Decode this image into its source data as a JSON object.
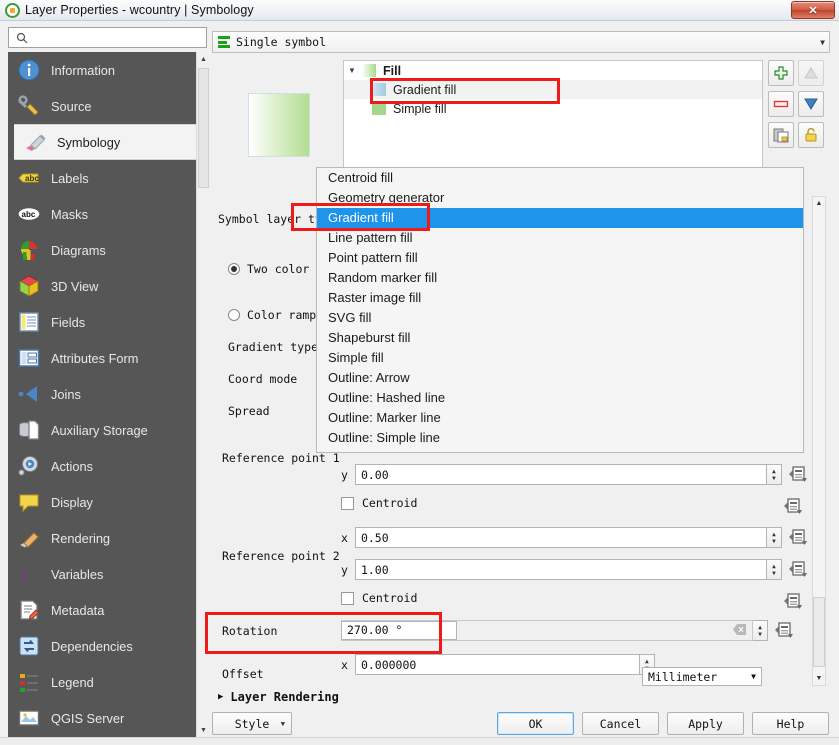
{
  "window": {
    "title": "Layer Properties - wcountry | Symbology",
    "app_icon": "qgis-icon",
    "close_label": "✕"
  },
  "search": {
    "value": "",
    "placeholder": "",
    "icon": "search-icon"
  },
  "sidebar": {
    "items": [
      {
        "label": "Information",
        "icon": "information-icon",
        "selected": false
      },
      {
        "label": "Source",
        "icon": "source-icon",
        "selected": false
      },
      {
        "label": "Symbology",
        "icon": "symbology-brush-icon",
        "selected": true
      },
      {
        "label": "Labels",
        "icon": "labels-abc-icon",
        "selected": false
      },
      {
        "label": "Masks",
        "icon": "masks-abc-icon",
        "selected": false
      },
      {
        "label": "Diagrams",
        "icon": "diagrams-chart-icon",
        "selected": false
      },
      {
        "label": "3D View",
        "icon": "cube-3d-icon",
        "selected": false
      },
      {
        "label": "Fields",
        "icon": "fields-table-icon",
        "selected": false
      },
      {
        "label": "Attributes Form",
        "icon": "attributes-form-icon",
        "selected": false
      },
      {
        "label": "Joins",
        "icon": "joins-icon",
        "selected": false
      },
      {
        "label": "Auxiliary Storage",
        "icon": "auxiliary-storage-icon",
        "selected": false
      },
      {
        "label": "Actions",
        "icon": "actions-gear-icon",
        "selected": false
      },
      {
        "label": "Display",
        "icon": "display-balloon-icon",
        "selected": false
      },
      {
        "label": "Rendering",
        "icon": "rendering-brush-icon",
        "selected": false
      },
      {
        "label": "Variables",
        "icon": "variables-epsilon-icon",
        "selected": false
      },
      {
        "label": "Metadata",
        "icon": "metadata-pencil-icon",
        "selected": false
      },
      {
        "label": "Dependencies",
        "icon": "dependencies-arrows-icon",
        "selected": false
      },
      {
        "label": "Legend",
        "icon": "legend-icon",
        "selected": false
      },
      {
        "label": "QGIS Server",
        "icon": "qgis-server-icon",
        "selected": false
      }
    ]
  },
  "renderer": {
    "label": "Single symbol",
    "icon": "single-symbol-icon"
  },
  "symbol_tree": {
    "rows": [
      {
        "label": "Fill",
        "swatch": "fill-gradient-swatch",
        "level": 0,
        "selected": false,
        "bold": true
      },
      {
        "label": "Gradient fill",
        "swatch": "gradient-fill-swatch",
        "level": 1,
        "selected": true,
        "bold": false
      },
      {
        "label": "Simple fill",
        "swatch": "simple-fill-swatch",
        "level": 1,
        "selected": false,
        "bold": false
      }
    ]
  },
  "layer_buttons": [
    {
      "name": "add-symbol-layer-button",
      "icon": "plus-icon",
      "disabled": false
    },
    {
      "name": "move-up-button",
      "icon": "triangle-up-icon",
      "disabled": true
    },
    {
      "name": "remove-symbol-layer-button",
      "icon": "minus-icon",
      "disabled": false
    },
    {
      "name": "move-down-button",
      "icon": "triangle-down-icon",
      "disabled": false
    },
    {
      "name": "duplicate-layer-button",
      "icon": "copy-icon",
      "disabled": false
    },
    {
      "name": "lock-layer-button",
      "icon": "lock-icon",
      "disabled": false
    }
  ],
  "form": {
    "symbol_layer_type_label": "Symbol layer type",
    "symbol_layer_type_value": "Gradient fill",
    "two_color_label": "Two color",
    "two_color_selected": true,
    "color_ramp_label": "Color ramp",
    "color_ramp_selected": false,
    "gradient_type_label": "Gradient type",
    "coord_mode_label": "Coord mode",
    "spread_label": "Spread",
    "reference_point_1_label": "Reference point 1",
    "reference_point_1_y_axis": "y",
    "reference_point_1_y": "0.00",
    "reference_point_1_centroid_label": "Centroid",
    "reference_point_2_label": "Reference point 2",
    "reference_point_2_x_axis": "x",
    "reference_point_2_x": "0.50",
    "reference_point_2_y_axis": "y",
    "reference_point_2_y": "1.00",
    "reference_point_2_centroid_label": "Centroid",
    "rotation_label": "Rotation",
    "rotation_value": "270.00 °",
    "offset_label": "Offset",
    "offset_x_axis": "x",
    "offset_x": "0.000000",
    "offset_unit": "Millimeter"
  },
  "dropdown": {
    "open": true,
    "selected": "Gradient fill",
    "options": [
      "Centroid fill",
      "Geometry generator",
      "Gradient fill",
      "Line pattern fill",
      "Point pattern fill",
      "Random marker fill",
      "Raster image fill",
      "SVG fill",
      "Shapeburst fill",
      "Simple fill",
      "Outline: Arrow",
      "Outline: Hashed line",
      "Outline: Marker line",
      "Outline: Simple line"
    ]
  },
  "layer_rendering": {
    "label": "Layer Rendering",
    "expanded": false
  },
  "buttons": {
    "style": "Style",
    "ok": "OK",
    "cancel": "Cancel",
    "apply": "Apply",
    "help": "Help"
  },
  "colors": {
    "highlight": "#1e94eb",
    "annotation": "#ef1b1b",
    "sidebar_bg": "#565656",
    "gradient_start": "#ffffff",
    "gradient_end": "#b2dd90"
  }
}
